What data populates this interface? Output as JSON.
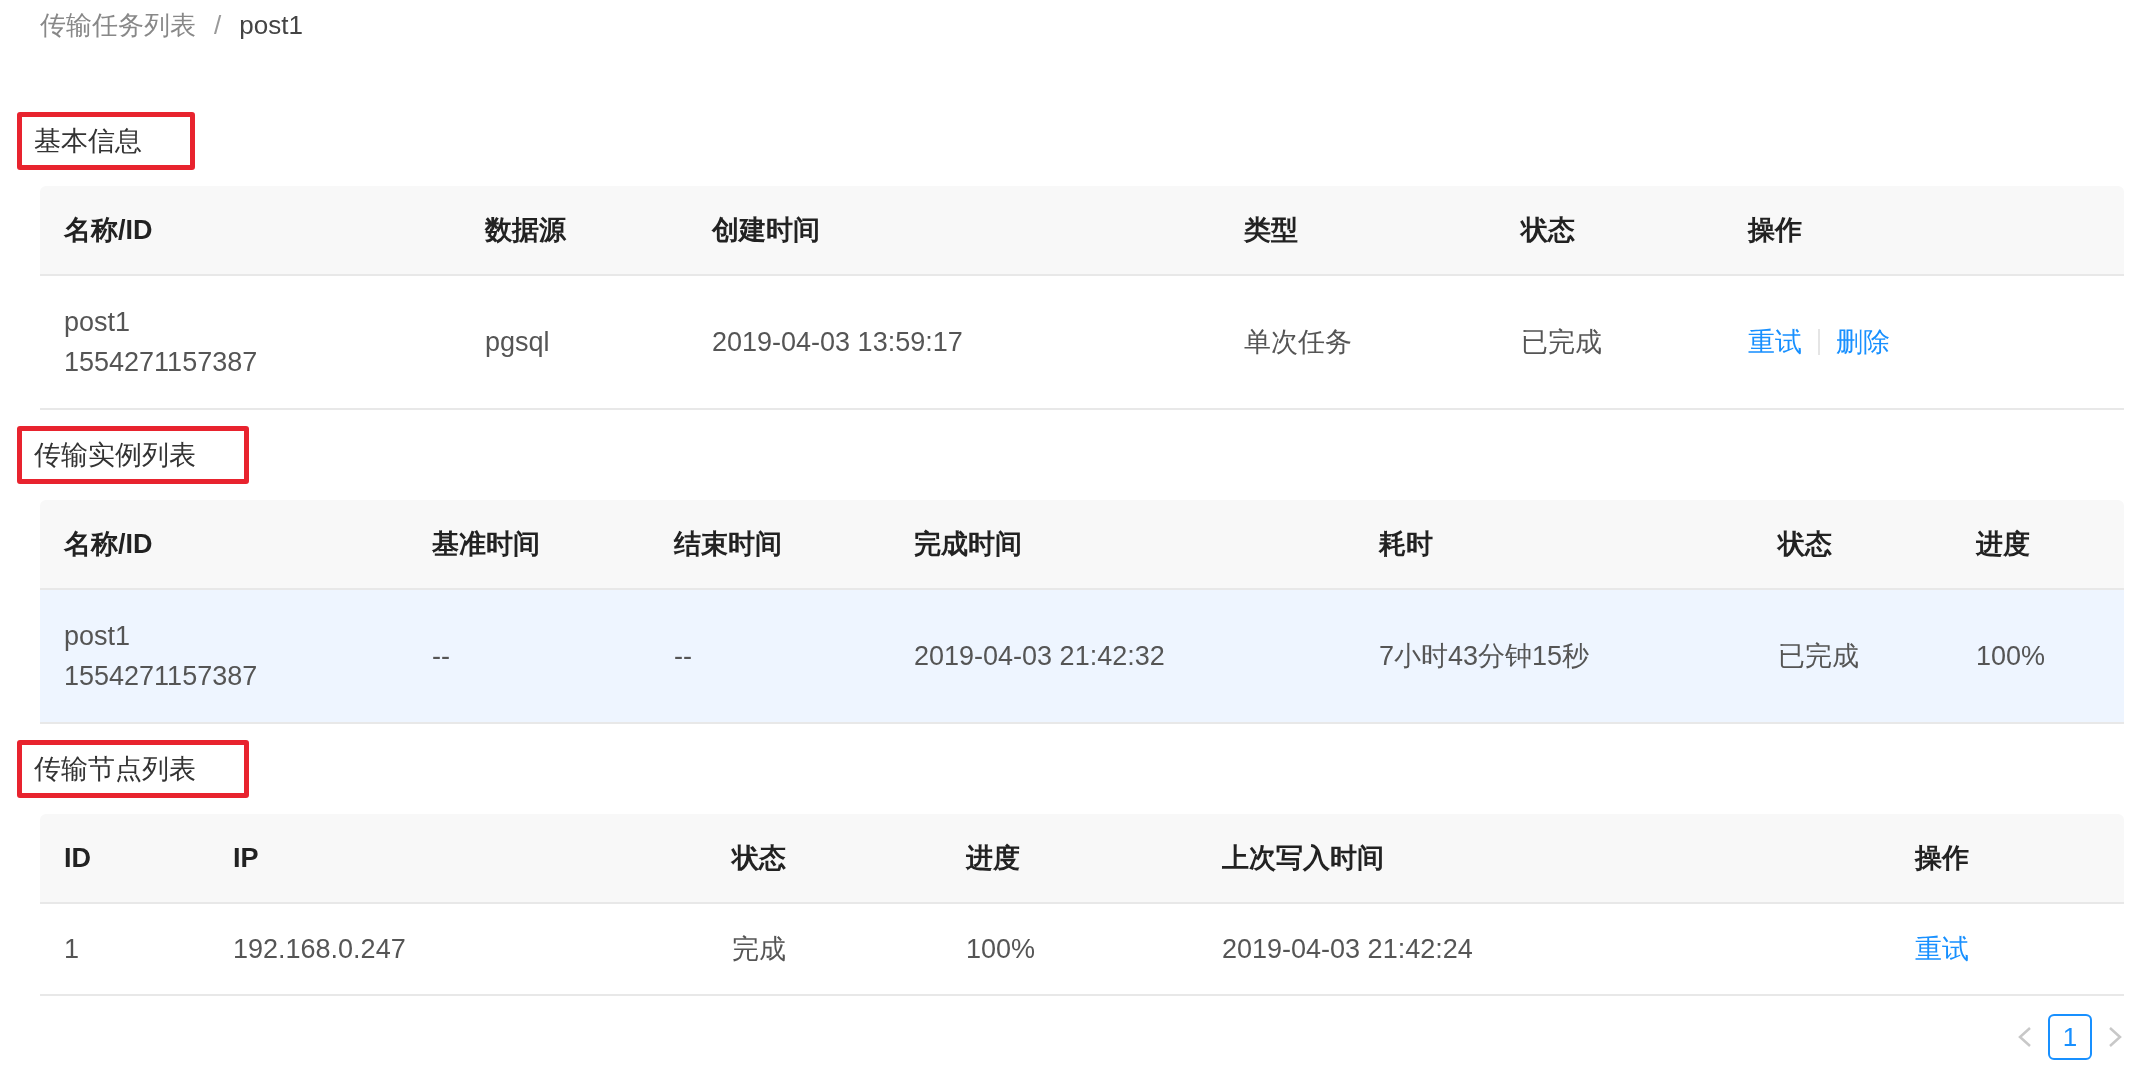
{
  "breadcrumb": [
    {
      "label": "传输任务列表",
      "kind": "link"
    },
    {
      "label": "/",
      "kind": "separator"
    },
    {
      "label": "post1",
      "kind": "current"
    }
  ],
  "sections": [
    {
      "title": "基本信息",
      "table": {
        "columns": [
          {
            "label": "名称/ID",
            "kind": "text"
          },
          {
            "label": "数据源",
            "kind": "text"
          },
          {
            "label": "创建时间",
            "kind": "text"
          },
          {
            "label": "类型",
            "kind": "text"
          },
          {
            "label": "状态",
            "kind": "text"
          },
          {
            "label": "操作",
            "kind": "actions"
          }
        ],
        "rows": [
          {
            "cells": [
              [
                "post1",
                "1554271157387"
              ],
              [
                "pgsql"
              ],
              [
                "2019-04-03 13:59:17"
              ],
              [
                "单次任务"
              ],
              [
                "已完成"
              ],
              [
                "重试",
                "删除"
              ]
            ]
          }
        ]
      }
    },
    {
      "title": "传输实例列表",
      "table": {
        "columns": [
          {
            "label": "名称/ID",
            "kind": "text"
          },
          {
            "label": "基准时间",
            "kind": "text"
          },
          {
            "label": "结束时间",
            "kind": "text"
          },
          {
            "label": "完成时间",
            "kind": "text"
          },
          {
            "label": "耗时",
            "kind": "text"
          },
          {
            "label": "状态",
            "kind": "text"
          },
          {
            "label": "进度",
            "kind": "text"
          }
        ],
        "rows": [
          {
            "selected": true,
            "cells": [
              [
                "post1",
                "1554271157387"
              ],
              [
                "--"
              ],
              [
                "--"
              ],
              [
                "2019-04-03 21:42:32"
              ],
              [
                "7小时43分钟15秒"
              ],
              [
                "已完成"
              ],
              [
                "100%"
              ]
            ]
          }
        ]
      }
    },
    {
      "title": "传输节点列表",
      "table": {
        "columns": [
          {
            "label": "ID",
            "kind": "text"
          },
          {
            "label": "IP",
            "kind": "text"
          },
          {
            "label": "状态",
            "kind": "text"
          },
          {
            "label": "进度",
            "kind": "text"
          },
          {
            "label": "上次写入时间",
            "kind": "text"
          },
          {
            "label": "操作",
            "kind": "actions"
          }
        ],
        "rows": [
          {
            "cells": [
              [
                "1"
              ],
              [
                "192.168.0.247"
              ],
              [
                "完成"
              ],
              [
                "100%"
              ],
              [
                "2019-04-03 21:42:24"
              ],
              [
                "重试"
              ]
            ]
          }
        ]
      }
    }
  ],
  "pagination": {
    "prev_disabled": true,
    "next_disabled": true,
    "pages": [
      {
        "label": "1",
        "selected": true
      }
    ]
  }
}
